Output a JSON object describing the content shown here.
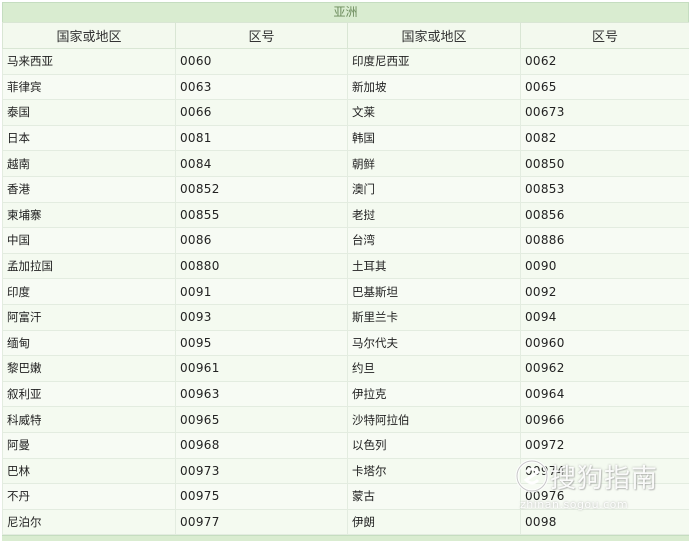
{
  "section_title": "亚洲",
  "headers": [
    "国家或地区",
    "区号",
    "国家或地区",
    "区号"
  ],
  "rows": [
    [
      "马来西亚",
      "0060",
      "印度尼西亚",
      "0062"
    ],
    [
      "菲律宾",
      "0063",
      "新加坡",
      "0065"
    ],
    [
      "泰国",
      "0066",
      "文莱",
      "00673"
    ],
    [
      "日本",
      "0081",
      "韩国",
      "0082"
    ],
    [
      "越南",
      "0084",
      "朝鲜",
      "00850"
    ],
    [
      "香港",
      "00852",
      "澳门",
      "00853"
    ],
    [
      "柬埔寨",
      "00855",
      "老挝",
      "00856"
    ],
    [
      "中国",
      "0086",
      "台湾",
      "00886"
    ],
    [
      "孟加拉国",
      "00880",
      "土耳其",
      "0090"
    ],
    [
      "印度",
      "0091",
      "巴基斯坦",
      "0092"
    ],
    [
      "阿富汗",
      "0093",
      "斯里兰卡",
      "0094"
    ],
    [
      "缅甸",
      "0095",
      "马尔代夫",
      "00960"
    ],
    [
      "黎巴嫩",
      "00961",
      "约旦",
      "00962"
    ],
    [
      "叙利亚",
      "00963",
      "伊拉克",
      "00964"
    ],
    [
      "科威特",
      "00965",
      "沙特阿拉伯",
      "00966"
    ],
    [
      "阿曼",
      "00968",
      "以色列",
      "00972"
    ],
    [
      "巴林",
      "00973",
      "卡塔尔",
      "00974"
    ],
    [
      "不丹",
      "00975",
      "蒙古",
      "00976"
    ],
    [
      "尼泊尔",
      "00977",
      "伊朗",
      "0098"
    ]
  ],
  "watermark": {
    "text": "搜狗指南",
    "url": "zhinan.sogou.com"
  }
}
